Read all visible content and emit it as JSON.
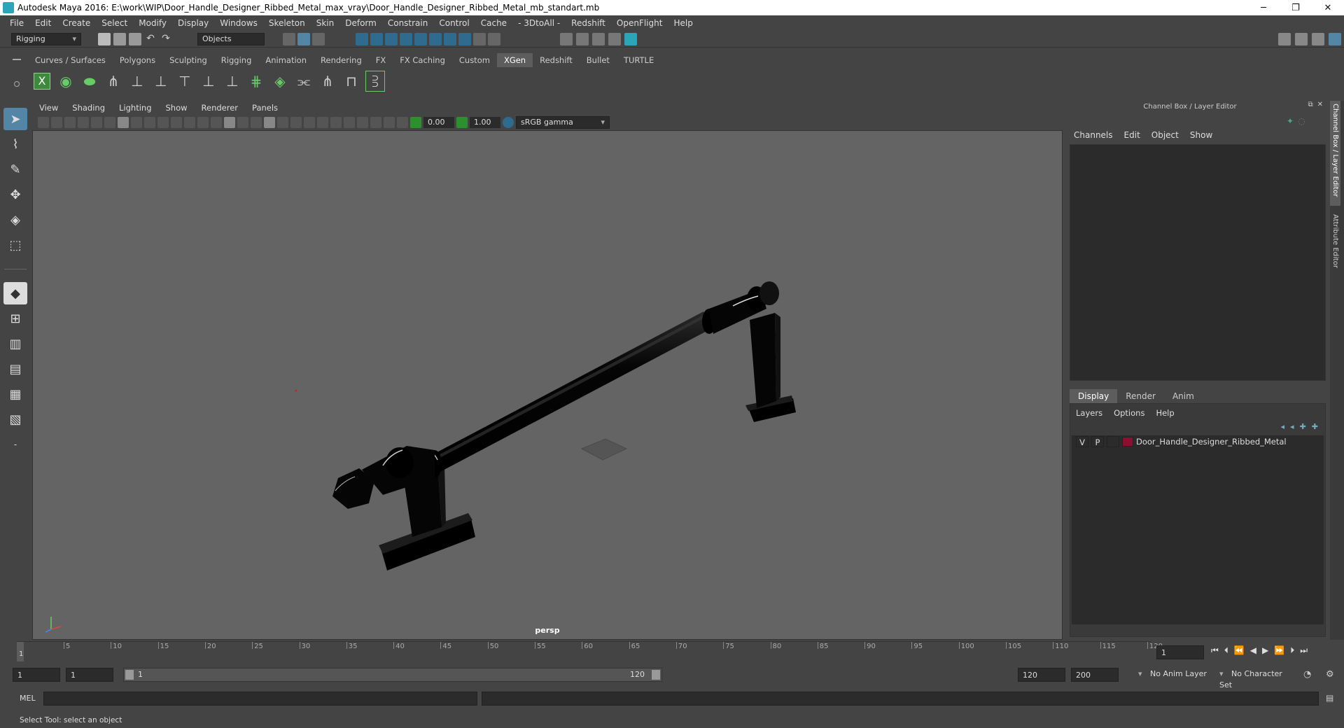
{
  "window": {
    "title": "Autodesk Maya 2016: E:\\work\\WIP\\Door_Handle_Designer_Ribbed_Metal_max_vray\\Door_Handle_Designer_Ribbed_Metal_mb_standart.mb",
    "min": "─",
    "restore": "❐",
    "close": "✕"
  },
  "menubar": [
    "File",
    "Edit",
    "Create",
    "Select",
    "Modify",
    "Display",
    "Windows",
    "Skeleton",
    "Skin",
    "Deform",
    "Constrain",
    "Control",
    "Cache",
    "- 3DtoAll -",
    "Redshift",
    "OpenFlight",
    "Help"
  ],
  "statusline": {
    "menu_set": "Rigging",
    "selection_mode": "Objects"
  },
  "shelf": {
    "tabs": [
      "Curves / Surfaces",
      "Polygons",
      "Sculpting",
      "Rigging",
      "Animation",
      "Rendering",
      "FX",
      "FX Caching",
      "Custom",
      "XGen",
      "Redshift",
      "Bullet",
      "TURTLE"
    ],
    "active_tab": "XGen"
  },
  "viewport": {
    "menu": [
      "View",
      "Shading",
      "Lighting",
      "Show",
      "Renderer",
      "Panels"
    ],
    "exposure": "0.00",
    "gamma": "1.00",
    "color_space": "sRGB gamma",
    "camera_label": "persp"
  },
  "right_panel": {
    "title": "Channel Box / Layer Editor",
    "channel_menu": [
      "Channels",
      "Edit",
      "Object",
      "Show"
    ],
    "layer_tabs": [
      "Display",
      "Render",
      "Anim"
    ],
    "active_layer_tab": "Display",
    "layer_menu": [
      "Layers",
      "Options",
      "Help"
    ],
    "layers": [
      {
        "v": "V",
        "p": "P",
        "name": "Door_Handle_Designer_Ribbed_Metal",
        "color": "#8b1030"
      }
    ],
    "side_tabs": [
      "Channel Box / Layer Editor",
      "Attribute Editor"
    ]
  },
  "timeline": {
    "ticks": [
      "5",
      "10",
      "15",
      "20",
      "25",
      "30",
      "35",
      "40",
      "45",
      "50",
      "55",
      "60",
      "65",
      "70",
      "75",
      "80",
      "85",
      "90",
      "95",
      "100",
      "105",
      "110",
      "115",
      "120"
    ],
    "first_tick": "1",
    "current_frame": "1"
  },
  "range": {
    "start": "1",
    "playback_start": "1",
    "slider_start": "1",
    "slider_end": "120",
    "playback_end": "120",
    "end": "200",
    "anim_layer": "No Anim Layer",
    "character_set": "No Character Set"
  },
  "command_line": {
    "label": "MEL"
  },
  "help_line": "Select Tool: select an object"
}
